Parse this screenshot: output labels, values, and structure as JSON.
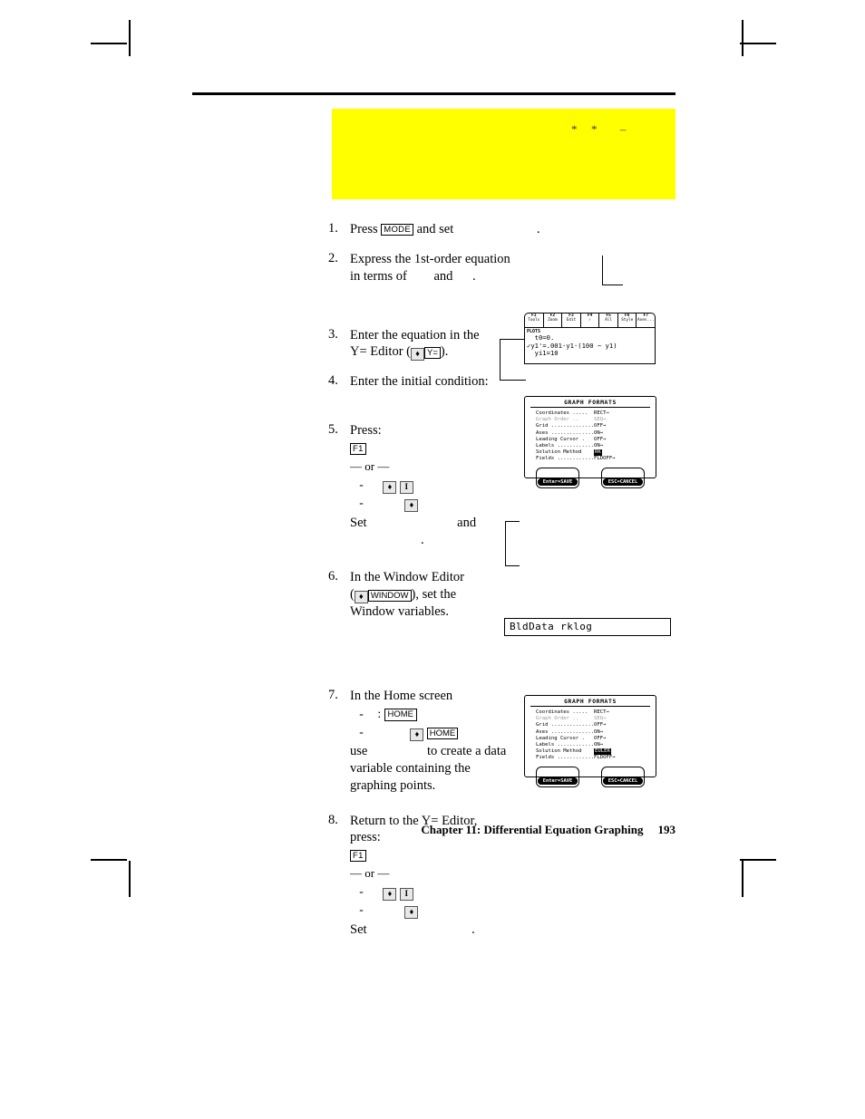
{
  "page": {
    "footer_chapter": "Chapter 11: Differential Equation Graphing",
    "footer_page": "193"
  },
  "redaction_band": {
    "mark_asterisk_1": "*",
    "mark_asterisk_2": "*",
    "mark_dash": "–"
  },
  "steps": [
    {
      "num": "1.",
      "line1_a": "Press",
      "key_mode": "MODE",
      "line1_b": "and set",
      "line1_c": "."
    },
    {
      "num": "2.",
      "line1": "Express the 1st-order equation",
      "line2_a": "in terms of",
      "line2_b": "and",
      "line2_c": ".",
      "mark_asterisk": "*",
      "mark_dash": "–"
    },
    {
      "num": "3.",
      "line1": "Enter the equation in the",
      "line2_a": "Y= Editor (",
      "key_diamond": "♦",
      "key_yequals": "Y=",
      "line2_b": ")."
    },
    {
      "num": "4.",
      "line1": "Enter the initial condition:"
    },
    {
      "num": "5.",
      "line1": "Press:",
      "key_f1": "F1",
      "or_text": "— or —",
      "sub1_dash": "-",
      "sub1_key_diamond": "♦",
      "sub1_key_bar": "I",
      "sub2_dash": "-",
      "sub2_key_diamond": "♦",
      "set_a": "Set",
      "set_b": "and",
      "set_c": "."
    },
    {
      "num": "6.",
      "line1": "In the Window Editor",
      "line2_a": "(",
      "key_diamond": "♦",
      "key_window": "WINDOW",
      "line2_b": "), set the",
      "line3": "Window variables."
    },
    {
      "num": "7.",
      "line1": "In the Home screen",
      "sub1_dash": "-",
      "sub1_colon": ":",
      "sub1_key": "HOME",
      "sub2_dash": "-",
      "sub2_key_diamond": "♦",
      "sub2_key": "HOME",
      "line2_a": "use",
      "line2_b": "to create a data",
      "line3": "variable containing the",
      "line4": "graphing points."
    },
    {
      "num": "8.",
      "line1": "Return to the Y= Editor,",
      "line2": "press:",
      "key_f1": "F1",
      "or_text": "— or —",
      "sub1_dash": "-",
      "sub1_key_diamond": "♦",
      "sub1_key_bar": "I",
      "sub2_dash": "-",
      "sub2_key_diamond": "♦",
      "set_a": "Set",
      "set_b": "."
    }
  ],
  "y_editor": {
    "toolbar": [
      {
        "fkey": "F1",
        "label": "Tools"
      },
      {
        "fkey": "F2",
        "label": "Zoom"
      },
      {
        "fkey": "F3",
        "label": "Edit"
      },
      {
        "fkey": "F4",
        "label": "✓"
      },
      {
        "fkey": "F5",
        "label": "All"
      },
      {
        "fkey": "F6",
        "label": "Style"
      },
      {
        "fkey": "F7",
        "label": "Axes..."
      }
    ],
    "header": "PLOTS",
    "lines": [
      "  t0=0.",
      "✓y1'=.001·y1·(100 − y1)",
      "  yi1=10"
    ]
  },
  "graph_formats_1": {
    "title": "GRAPH FORMATS",
    "rows": [
      {
        "label": "Coordinates .....",
        "value": "RECT→",
        "state": "normal"
      },
      {
        "label": "Graph Order ..",
        "value": "SEQ→",
        "state": "faded"
      },
      {
        "label": "Grid ................",
        "value": "OFF→",
        "state": "normal"
      },
      {
        "label": "Axes ...............",
        "value": "ON→",
        "state": "normal"
      },
      {
        "label": "Leading Cursor .",
        "value": "OFF→",
        "state": "normal"
      },
      {
        "label": "Labels ............",
        "value": "ON→",
        "state": "normal"
      },
      {
        "label": "Solution Method",
        "value": "RK",
        "state": "highlight"
      },
      {
        "label": "Fields .............",
        "value": "FLDOFF→",
        "state": "normal"
      }
    ],
    "button_save": "Enter=SAVE",
    "button_cancel": "ESC=CANCEL"
  },
  "graph_formats_2": {
    "title": "GRAPH FORMATS",
    "rows": [
      {
        "label": "Coordinates .....",
        "value": "RECT→",
        "state": "normal"
      },
      {
        "label": "Graph Order ..",
        "value": "SEQ→",
        "state": "faded"
      },
      {
        "label": "Grid ................",
        "value": "OFF→",
        "state": "normal"
      },
      {
        "label": "Axes ...............",
        "value": "ON→",
        "state": "normal"
      },
      {
        "label": "Leading Cursor .",
        "value": "OFF→",
        "state": "normal"
      },
      {
        "label": "Labels ............",
        "value": "ON→",
        "state": "normal"
      },
      {
        "label": "Solution Method",
        "value": "EULER",
        "state": "highlight"
      },
      {
        "label": "Fields .............",
        "value": "FLDOFF→",
        "state": "normal"
      }
    ],
    "button_save": "Enter=SAVE",
    "button_cancel": "ESC=CANCEL"
  },
  "home_entry": {
    "command": "BldData rklog"
  }
}
